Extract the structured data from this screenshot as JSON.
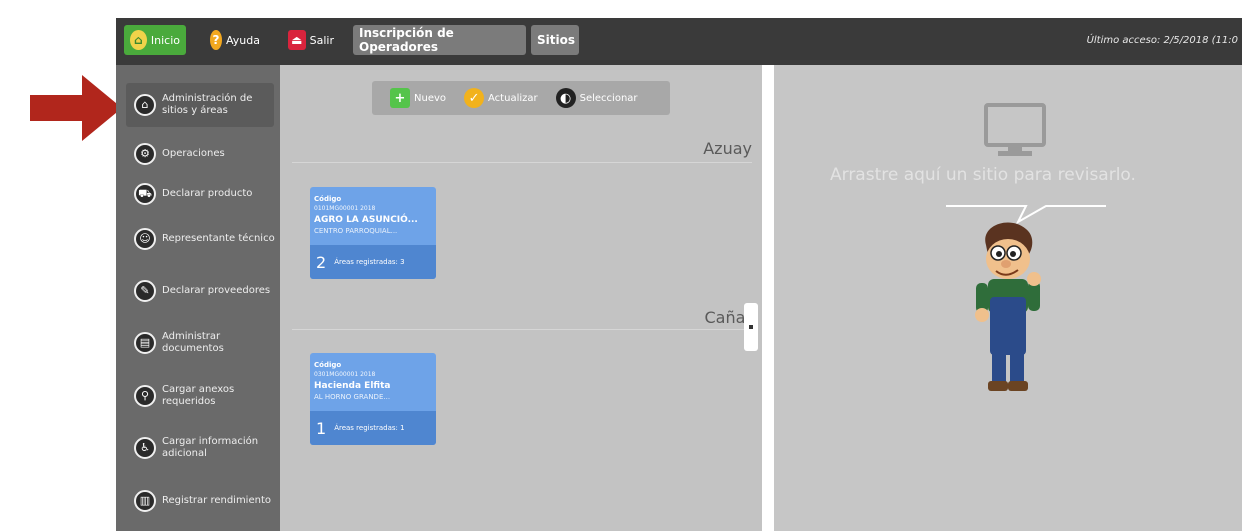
{
  "topbar": {
    "inicio_label": "Inicio",
    "ayuda_label": "Ayuda",
    "salir_label": "Salir",
    "inscripcion_label": "Inscripción de Operadores",
    "sitios_label": "Sitios",
    "last_access": "Último acceso: 2/5/2018 (11:0"
  },
  "sidebar": {
    "items": [
      {
        "label": "Administración de sitios y áreas",
        "icon": "sitios-icon"
      },
      {
        "label": "Operaciones",
        "icon": "operaciones-icon"
      },
      {
        "label": "Declarar producto",
        "icon": "cart-icon"
      },
      {
        "label": "Representante técnico",
        "icon": "person-icon"
      },
      {
        "label": "Declarar proveedores",
        "icon": "provider-icon"
      },
      {
        "label": "Administrar documentos",
        "icon": "documents-icon"
      },
      {
        "label": "Cargar anexos requeridos",
        "icon": "attach-icon"
      },
      {
        "label": "Cargar información adicional",
        "icon": "info-icon"
      },
      {
        "label": "Registrar rendimiento",
        "icon": "chart-icon"
      }
    ]
  },
  "toolbar": {
    "nuevo_label": "Nuevo",
    "actualizar_label": "Actualizar",
    "seleccionar_label": "Seleccionar"
  },
  "regions": [
    {
      "name": "Azuay"
    },
    {
      "name": "Cañar"
    }
  ],
  "cards": [
    {
      "label": "Código",
      "code": "0101MG00001 2018",
      "name": "AGRO LA ASUNCIÓ...",
      "sub": "CENTRO PARROQUIAL...",
      "count": "2",
      "areas": "Áreas registradas: 3"
    },
    {
      "label": "Código",
      "code": "0301MG00001 2018",
      "name": "Hacienda Elfita",
      "sub": "AL HORNO GRANDE...",
      "count": "1",
      "areas": "Áreas registradas: 1"
    }
  ],
  "right_panel": {
    "drop_hint": "Arrastre aquí un sitio para revisarlo."
  },
  "colors": {
    "topbar": "#3a3a3a",
    "sidebar": "#6a6a6a",
    "card": "#6ea3e8",
    "arrow": "#b1261c"
  }
}
